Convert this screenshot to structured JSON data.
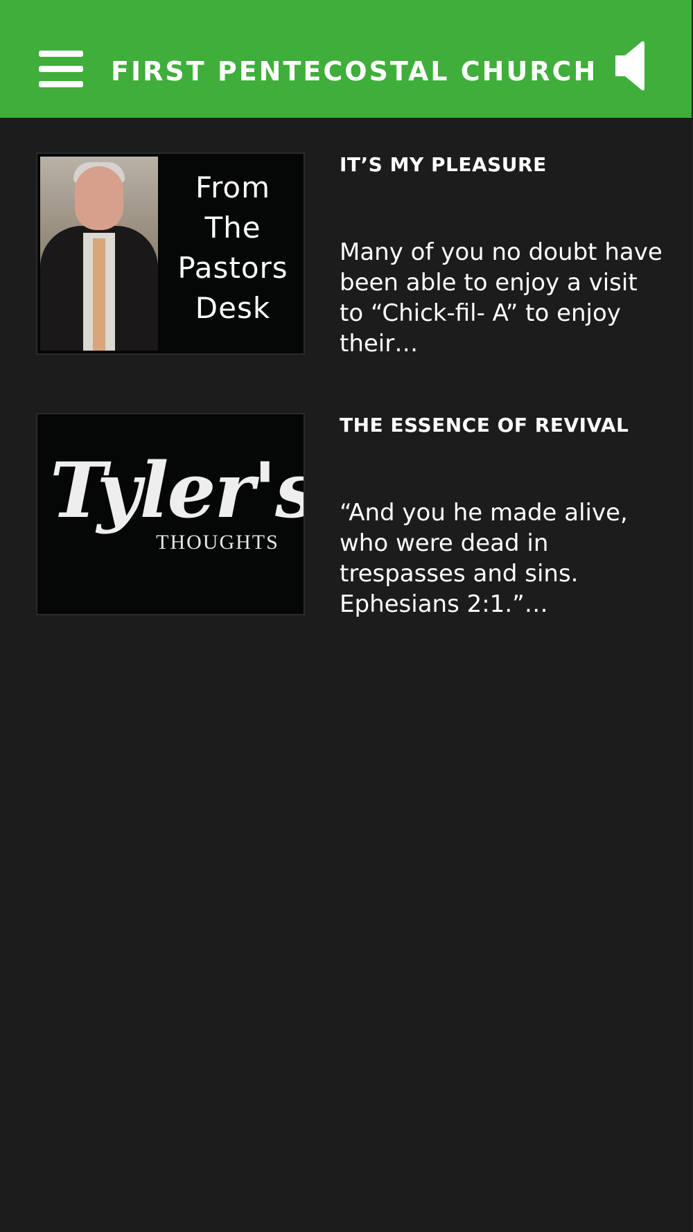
{
  "header": {
    "title": "FIRST PENTECOSTAL CHURCH",
    "menu_icon": "hamburger-menu-icon",
    "audio_icon": "speaker-icon",
    "background_color": "#3fae3a"
  },
  "posts": [
    {
      "title": "IT’S MY PLEASURE",
      "excerpt": "Many of you no doubt have been able to enjoy a visit to “Chick-fil- A” to enjoy their…",
      "thumbnail": {
        "lines": [
          "From",
          "The",
          "Pastors",
          "Desk"
        ]
      }
    },
    {
      "title": "THE ESSENCE OF REVIVAL",
      "excerpt": "“And you he made alive, who were dead in trespasses and sins. Ephesians 2:1.”…",
      "thumbnail": {
        "script": "Tyler's",
        "caps": "THOUGHTS"
      }
    }
  ],
  "colors": {
    "background": "#1c1c1c",
    "text": "#ffffff"
  }
}
